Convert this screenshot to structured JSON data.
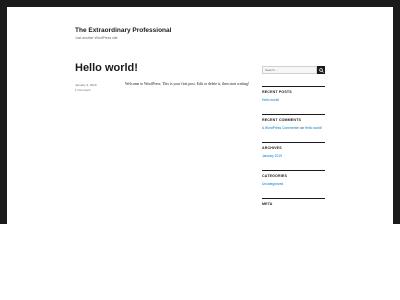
{
  "site": {
    "title": "The Extraordinary Professional",
    "description": "Just another WordPress site"
  },
  "post": {
    "title": "Hello world!",
    "date": "January 3, 2019",
    "comments": "1 Comment",
    "content": "Welcome to WordPress. This is your first post. Edit or delete it, then start writing!"
  },
  "sidebar": {
    "search_placeholder": "Search ...",
    "search_icon": "search-icon",
    "recent_posts": {
      "heading": "RECENT POSTS",
      "items": [
        "Hello world!"
      ]
    },
    "recent_comments": {
      "heading": "RECENT COMMENTS",
      "author": "A WordPress Commenter",
      "connector": "on",
      "post": "Hello world!"
    },
    "archives": {
      "heading": "ARCHIVES",
      "items": [
        "January 2019"
      ]
    },
    "categories": {
      "heading": "CATEGORIES",
      "items": [
        "Uncategorized"
      ]
    },
    "meta": {
      "heading": "META"
    }
  },
  "colors": {
    "frame": "#1a1a1a",
    "link": "#007acc",
    "text": "#1a1a1a",
    "muted": "#686868"
  }
}
